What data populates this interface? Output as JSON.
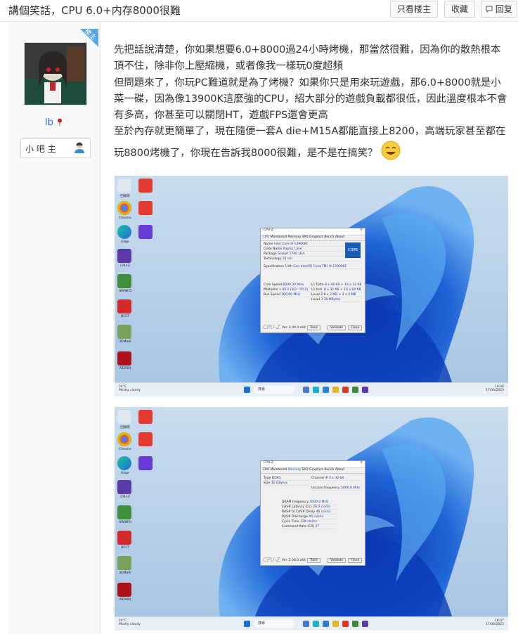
{
  "header": {
    "title": "講個笑話，CPU 6.0+内存8000很難",
    "buttons": [
      "只看楼主",
      "收藏",
      "回复"
    ]
  },
  "author": {
    "badge": "楼主",
    "name": "lb",
    "role": "小 吧 主"
  },
  "post": {
    "paragraphs": [
      "先把話說清楚，你如果想要6.0+8000過24小時烤機，那當然很難，因為你的散熱根本頂不住，除非你上壓縮機，或者像我一樣玩0度超頻",
      "但問題來了，你玩PC難道就是為了烤機？如果你只是用來玩遊戲，那6.0+8000就是小菜一碟，因為像13900K這麼強的CPU，紹大部分的遊戲負載都很低，因此溫度根本不會有多高，你甚至可以關閉HT，遊戲FPS還會更高",
      "至於內存就更簡單了，現在隨便一套A die+M15A都能直接上8200，高端玩家甚至都在玩8800烤機了，你現在告訴我8000很難，是不是在搞笑？"
    ]
  },
  "screenshots": [
    {
      "window_title": "CPU-Z",
      "active_tab": "CPU",
      "tabs": [
        "CPU",
        "Mainboard",
        "Memory",
        "SPD",
        "Graphics",
        "Bench",
        "About"
      ],
      "fields": [
        [
          "Name",
          "Intel Core i9 13900KF"
        ],
        [
          "Code Name",
          "Raptor Lake"
        ],
        [
          "Package",
          "Socket 1700 LGA"
        ],
        [
          "Technology",
          "10 nm"
        ],
        [
          "Specification",
          "13th Gen Intel(R) Core(TM) i9-13900KF"
        ],
        [
          "Core Speed",
          "6000.00 MHz"
        ],
        [
          "Multiplier",
          "x 60.0 (8.0 - 55.0)"
        ],
        [
          "Bus Speed",
          "100.00 MHz"
        ]
      ],
      "cache": [
        [
          "L1 Data",
          "8 x 48 KB + 16 x 32 KB"
        ],
        [
          "L1 Inst.",
          "8 x 32 KB + 16 x 64 KB"
        ],
        [
          "Level 2",
          "8 x 2 MB + 4 x 4 MB"
        ],
        [
          "Level 3",
          "36 MBytes"
        ]
      ],
      "brand": "CPU-Z",
      "version": "Ver. 2.04.0.x64",
      "tools_label": "Tools",
      "validate_label": "Validate",
      "close_label": "Close",
      "weather": "24°C",
      "weather_sub": "Mostly cloudy",
      "search": "搜尋",
      "clock_time": "18:46",
      "clock_date": "17/06/2023"
    },
    {
      "window_title": "CPU-Z",
      "active_tab": "Memory",
      "tabs": [
        "CPU",
        "Mainboard",
        "Memory",
        "SPD",
        "Graphics",
        "Bench",
        "About"
      ],
      "fields": [
        [
          "Type",
          "DDR5"
        ],
        [
          "Size",
          "32 GBytes"
        ],
        [
          "Channel #",
          "4 x 32-bit"
        ],
        [
          "Uncore Frequency",
          "5000.0 MHz"
        ],
        [
          "DRAM Frequency",
          "4000.0 MHz"
        ],
        [
          "CAS# Latency (CL)",
          "36.0 clocks"
        ],
        [
          "RAS# to CAS# Delay",
          "46 clocks"
        ],
        [
          "RAS# Precharge",
          "46 clocks"
        ],
        [
          "Cycle Time",
          "128 clocks"
        ],
        [
          "Command Rate (CR)",
          "2T"
        ]
      ],
      "brand": "CPU-Z",
      "version": "Ver. 2.04.0.x64",
      "tools_label": "Tools",
      "validate_label": "Validate",
      "close_label": "Close",
      "weather": "24°C",
      "weather_sub": "Mostly cloudy",
      "search": "搜尋",
      "clock_time": "18:47",
      "clock_date": "17/06/2023"
    }
  ],
  "desktop_icons": [
    "回收筒",
    "Chrome",
    "Edge",
    "CPU-Z",
    "HWiNFO",
    "AIDA64",
    "3DMark",
    "OCCT",
    "PDF",
    "PDF",
    "ASUS"
  ],
  "colors": {
    "accent_blue": "#3366cc",
    "badge_blue": "#5aa5e8",
    "desktop_bg": "#b9d3ea",
    "bloom_blue": "#1e63d6"
  }
}
